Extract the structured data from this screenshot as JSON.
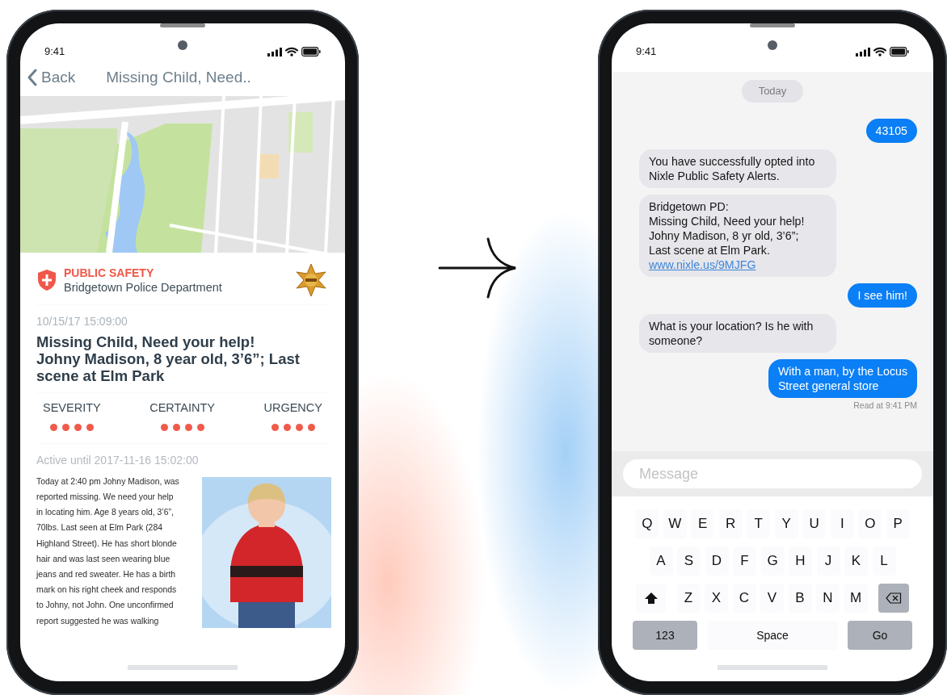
{
  "alert_phone": {
    "status_time": "9:41",
    "back": "Back",
    "title": "Missing Child, Need..",
    "agency": {
      "category": "PUBLIC SAFETY",
      "name": "Bridgetown Police Department"
    },
    "timestamp": "10/15/17 15:09:00",
    "headline": "Missing Child, Need your help!\nJohny Madison, 8 year old, 3’6”; Last scene at Elm Park",
    "ratings": [
      {
        "label": "SEVERITY",
        "stars": 4
      },
      {
        "label": "CERTAINTY",
        "stars": 4
      },
      {
        "label": "URGENCY",
        "stars": 4
      }
    ],
    "active_until": "Active until 2017-11-16 15:02:00",
    "description": "Today at 2:40 pm Johny Madison, was\nreported missing. We need your help\nin locating him. Age 8 years old, 3’6”,\n70lbs. Last seen at Elm Park (284\nHighland Street). He has short blonde\nhair and was last seen wearing blue\njeans and red sweater. He has a birth\nmark on his right cheek and responds\nto Johny, not John. One unconfirmed\nreport suggested he was walking"
  },
  "messages_phone": {
    "status_time": "9:41",
    "day": "Today",
    "messages": [
      {
        "kind": "sent",
        "text": "43105"
      },
      {
        "kind": "received",
        "text": "You have successfully opted into\nNixle Public Safety Alerts."
      },
      {
        "kind": "received",
        "text": "Bridgetown PD:\nMissing Child, Need your help!\nJohny Madison, 8 yr old, 3’6”;\nLast scene at Elm Park.",
        "link": "www.nixle.us/9MJFG"
      },
      {
        "kind": "sent",
        "text": "I see him!"
      },
      {
        "kind": "received",
        "text": "What is your location? Is he with\nsomeone?"
      },
      {
        "kind": "sent",
        "text": "With a man, by the Locus\nStreet general store"
      }
    ],
    "receipt": "Read at 9:41 PM",
    "input": {
      "placeholder": "Message"
    },
    "keyboard": {
      "rows": [
        [
          "Q",
          "W",
          "E",
          "R",
          "T",
          "Y",
          "U",
          "I",
          "O",
          "P"
        ],
        [
          "A",
          "S",
          "D",
          "F",
          "G",
          "H",
          "J",
          "K",
          "L"
        ],
        [
          "Z",
          "X",
          "C",
          "V",
          "B",
          "N",
          "M"
        ]
      ],
      "bottom_keys": [
        {
          "label": "123",
          "kind": "function"
        },
        {
          "label": "Space",
          "kind": "space"
        },
        {
          "label": "Go",
          "kind": "function"
        }
      ]
    }
  }
}
